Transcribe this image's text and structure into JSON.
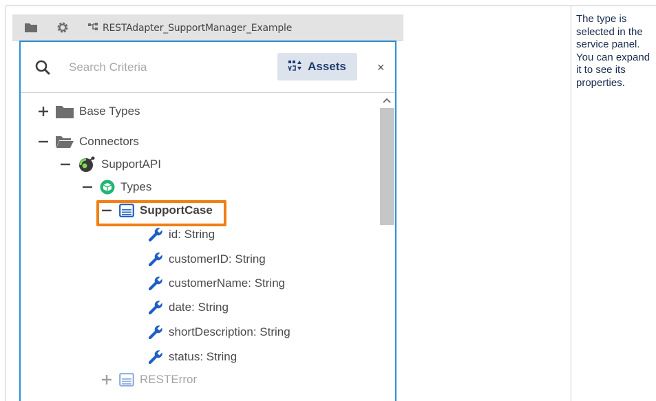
{
  "toolbar": {
    "folder_icon": "folder-icon",
    "settings_icon": "gear-icon",
    "project_icon": "project-tree-icon",
    "project_name": "RESTAdapter_SupportManager_Example"
  },
  "search": {
    "placeholder": "Search Criteria",
    "assets_label": "Assets",
    "close_glyph": "×"
  },
  "tree": {
    "base_types": "Base Types",
    "connectors": "Connectors",
    "support_api": "SupportAPI",
    "types": "Types",
    "support_case": "SupportCase",
    "properties": [
      "id: String",
      "customerID: String",
      "customerName: String",
      "date: String",
      "shortDescription: String",
      "status: String"
    ],
    "rest_error": "RESTError"
  },
  "note": "The type is selected in the service panel. You can expand it to see its properties.",
  "colors": {
    "panel_border": "#2b8fd8",
    "highlight": "#f07f14",
    "wrench": "#1f5fc4",
    "types_icon": "#22b573",
    "assets_bg": "#dde3ec"
  }
}
